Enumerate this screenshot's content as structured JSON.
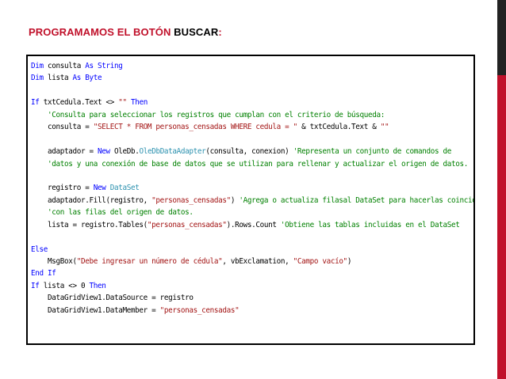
{
  "slide": {
    "title_part1": "PROGRAMAMOS EL BOTÓN",
    "title_part2": "BUSCAR",
    "title_part3": ":"
  },
  "colors": {
    "accent_red": "#c0102a",
    "keyword": "#0000ff",
    "string": "#a31515",
    "comment": "#008000",
    "type": "#2b91af"
  },
  "code_lines": [
    [
      {
        "t": "kw",
        "v": "Dim"
      },
      {
        "t": "pl",
        "v": " consulta "
      },
      {
        "t": "kw",
        "v": "As"
      },
      {
        "t": "pl",
        "v": " "
      },
      {
        "t": "kw",
        "v": "String"
      }
    ],
    [
      {
        "t": "kw",
        "v": "Dim"
      },
      {
        "t": "pl",
        "v": " lista "
      },
      {
        "t": "kw",
        "v": "As"
      },
      {
        "t": "pl",
        "v": " "
      },
      {
        "t": "kw",
        "v": "Byte"
      }
    ],
    [],
    [
      {
        "t": "kw",
        "v": "If"
      },
      {
        "t": "pl",
        "v": " txtCedula.Text <> "
      },
      {
        "t": "str",
        "v": "\"\""
      },
      {
        "t": "pl",
        "v": " "
      },
      {
        "t": "kw",
        "v": "Then"
      }
    ],
    [
      {
        "t": "pl",
        "v": "    "
      },
      {
        "t": "cmt",
        "v": "'Consulta para seleccionar los registros que cumplan con el criterio de búsqueda:"
      }
    ],
    [
      {
        "t": "pl",
        "v": "    consulta = "
      },
      {
        "t": "str",
        "v": "\"SELECT * FROM personas_censadas WHERE cedula = \""
      },
      {
        "t": "pl",
        "v": " & txtCedula.Text & "
      },
      {
        "t": "str",
        "v": "\"\""
      }
    ],
    [],
    [
      {
        "t": "pl",
        "v": "    adaptador = "
      },
      {
        "t": "kw",
        "v": "New"
      },
      {
        "t": "pl",
        "v": " OleDb."
      },
      {
        "t": "type",
        "v": "OleDbDataAdapter"
      },
      {
        "t": "pl",
        "v": "(consulta, conexion) "
      },
      {
        "t": "cmt",
        "v": "'Representa un conjunto de comandos de"
      }
    ],
    [
      {
        "t": "pl",
        "v": "    "
      },
      {
        "t": "cmt",
        "v": "'datos y una conexión de base de datos que se utilizan para rellenar y actualizar el origen de datos."
      }
    ],
    [],
    [
      {
        "t": "pl",
        "v": "    registro = "
      },
      {
        "t": "kw",
        "v": "New"
      },
      {
        "t": "pl",
        "v": " "
      },
      {
        "t": "type",
        "v": "DataSet"
      }
    ],
    [
      {
        "t": "pl",
        "v": "    adaptador.Fill(registro, "
      },
      {
        "t": "str",
        "v": "\"personas_censadas\""
      },
      {
        "t": "pl",
        "v": ") "
      },
      {
        "t": "cmt",
        "v": "'Agrega o actualiza filasal DataSet para hacerlas coincidir"
      }
    ],
    [
      {
        "t": "pl",
        "v": "    "
      },
      {
        "t": "cmt",
        "v": "'con las filas del origen de datos."
      }
    ],
    [
      {
        "t": "pl",
        "v": "    lista = registro.Tables("
      },
      {
        "t": "str",
        "v": "\"personas_censadas\""
      },
      {
        "t": "pl",
        "v": ").Rows.Count "
      },
      {
        "t": "cmt",
        "v": "'Obtiene las tablas incluidas en el DataSet"
      }
    ],
    [],
    [
      {
        "t": "kw",
        "v": "Else"
      }
    ],
    [
      {
        "t": "pl",
        "v": "    MsgBox("
      },
      {
        "t": "str",
        "v": "\"Debe ingresar un número de cédula\""
      },
      {
        "t": "pl",
        "v": ", vbExclamation, "
      },
      {
        "t": "str",
        "v": "\"Campo vacío\""
      },
      {
        "t": "pl",
        "v": ")"
      }
    ],
    [
      {
        "t": "kw",
        "v": "End"
      },
      {
        "t": "pl",
        "v": " "
      },
      {
        "t": "kw",
        "v": "If"
      }
    ],
    [
      {
        "t": "kw",
        "v": "If"
      },
      {
        "t": "pl",
        "v": " lista <> 0 "
      },
      {
        "t": "kw",
        "v": "Then"
      }
    ],
    [
      {
        "t": "pl",
        "v": "    DataGridView1.DataSource = registro"
      }
    ],
    [
      {
        "t": "pl",
        "v": "    DataGridView1.DataMember = "
      },
      {
        "t": "str",
        "v": "\"personas_censadas\""
      }
    ]
  ]
}
